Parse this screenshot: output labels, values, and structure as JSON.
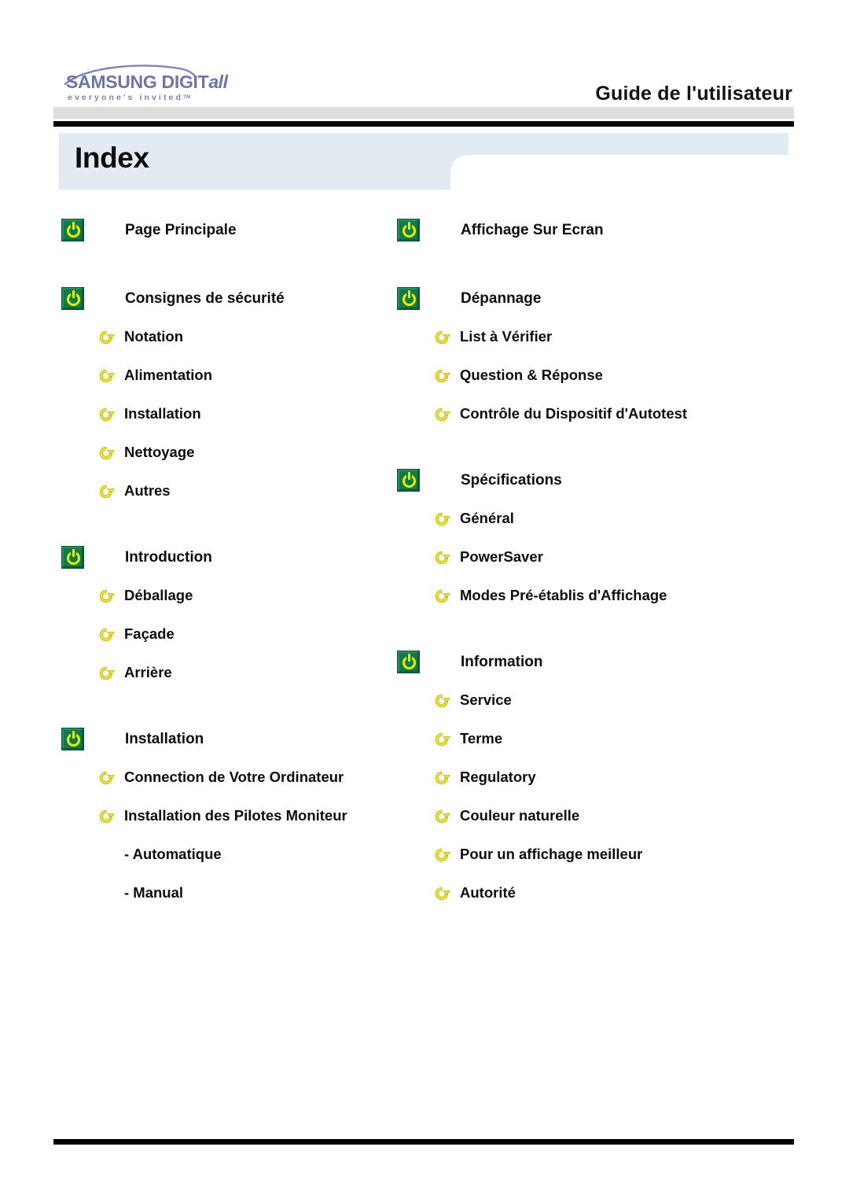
{
  "header": {
    "logo_wordmark_main": "SAMSUNG DIGIT",
    "logo_wordmark_italic": "all",
    "logo_tagline": "everyone's invited",
    "logo_tagline_tm": "TM",
    "title": "Guide de l'utilisateur",
    "logo_color": "#6d76ab"
  },
  "banner": {
    "title": "Index",
    "background_color": "#e2ebf1"
  },
  "colors": {
    "section_icon_green": "#127a48",
    "section_icon_symbol": "#e4f000",
    "sub_icon_yellow": "#e8dd33",
    "rule_black": "#000000",
    "gray_band": "#dddddd"
  },
  "columns": {
    "left": [
      {
        "section": {
          "label": "Page Principale",
          "icon": "green-power-icon"
        },
        "items": []
      },
      {
        "section": {
          "label": "Consignes de sécurité",
          "icon": "green-power-icon"
        },
        "items": [
          {
            "label": "Notation",
            "icon": "yellow-arrow-icon",
            "type": "sub"
          },
          {
            "label": "Alimentation",
            "icon": "yellow-arrow-icon",
            "type": "sub"
          },
          {
            "label": "Installation",
            "icon": "yellow-arrow-icon",
            "type": "sub"
          },
          {
            "label": "Nettoyage",
            "icon": "yellow-arrow-icon",
            "type": "sub"
          },
          {
            "label": "Autres",
            "icon": "yellow-arrow-icon",
            "type": "sub"
          }
        ]
      },
      {
        "section": {
          "label": "Introduction",
          "icon": "green-power-icon"
        },
        "items": [
          {
            "label": "Déballage",
            "icon": "yellow-arrow-icon",
            "type": "sub"
          },
          {
            "label": "Façade",
            "icon": "yellow-arrow-icon",
            "type": "sub"
          },
          {
            "label": "Arrière",
            "icon": "yellow-arrow-icon",
            "type": "sub"
          }
        ]
      },
      {
        "section": {
          "label": "Installation",
          "icon": "green-power-icon"
        },
        "items": [
          {
            "label": "Connection de Votre Ordinateur",
            "icon": "yellow-arrow-icon",
            "type": "sub"
          },
          {
            "label": "Installation des Pilotes Moniteur",
            "icon": "yellow-arrow-icon",
            "type": "sub"
          },
          {
            "label": "- Automatique",
            "icon": null,
            "type": "subsub"
          },
          {
            "label": "- Manual",
            "icon": null,
            "type": "subsub"
          }
        ]
      }
    ],
    "right": [
      {
        "section": {
          "label": "Affichage Sur Ecran",
          "icon": "green-power-icon"
        },
        "items": []
      },
      {
        "section": {
          "label": "Dépannage",
          "icon": "green-power-icon"
        },
        "items": [
          {
            "label": "List à Vérifier",
            "icon": "yellow-arrow-icon",
            "type": "sub"
          },
          {
            "label": "Question & Réponse",
            "icon": "yellow-arrow-icon",
            "type": "sub"
          },
          {
            "label": "Contrôle du Dispositif d'Autotest",
            "icon": "yellow-arrow-icon",
            "type": "sub"
          }
        ]
      },
      {
        "section": {
          "label": "Spécifications",
          "icon": "green-power-icon"
        },
        "items": [
          {
            "label": "Général",
            "icon": "yellow-arrow-icon",
            "type": "sub"
          },
          {
            "label": "PowerSaver",
            "icon": "yellow-arrow-icon",
            "type": "sub"
          },
          {
            "label": "Modes Pré-établis d'Affichage",
            "icon": "yellow-arrow-icon",
            "type": "sub"
          }
        ]
      },
      {
        "section": {
          "label": "Information",
          "icon": "green-power-icon"
        },
        "items": [
          {
            "label": "Service",
            "icon": "yellow-arrow-icon",
            "type": "sub"
          },
          {
            "label": "Terme",
            "icon": "yellow-arrow-icon",
            "type": "sub"
          },
          {
            "label": "Regulatory",
            "icon": "yellow-arrow-icon",
            "type": "sub"
          },
          {
            "label": "Couleur naturelle",
            "icon": "yellow-arrow-icon",
            "type": "sub"
          },
          {
            "label": "Pour un affichage meilleur",
            "icon": "yellow-arrow-icon",
            "type": "sub"
          },
          {
            "label": "Autorité",
            "icon": "yellow-arrow-icon",
            "type": "sub"
          }
        ]
      }
    ]
  }
}
